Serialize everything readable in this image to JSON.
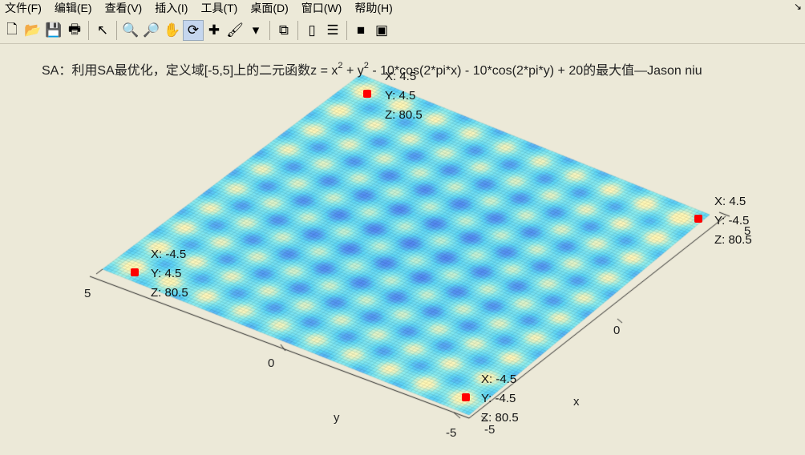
{
  "menu": [
    "文件(F)",
    "编辑(E)",
    "查看(V)",
    "插入(I)",
    "工具(T)",
    "桌面(D)",
    "窗口(W)",
    "帮助(H)"
  ],
  "corner_icon": "↘",
  "toolbar": [
    {
      "name": "new-figure-icon",
      "glyph": "🗋"
    },
    {
      "name": "open-icon",
      "glyph": "📂"
    },
    {
      "name": "save-icon",
      "glyph": "💾"
    },
    {
      "name": "print-icon",
      "glyph": "🖶"
    },
    {
      "sep": true
    },
    {
      "name": "select-arrow-icon",
      "glyph": "↖"
    },
    {
      "sep": true
    },
    {
      "name": "zoom-in-icon",
      "glyph": "🔍"
    },
    {
      "name": "zoom-out-icon",
      "glyph": "🔎"
    },
    {
      "name": "pan-hand-icon",
      "glyph": "✋"
    },
    {
      "name": "rotate-3d-icon",
      "glyph": "⟳",
      "active": true
    },
    {
      "name": "data-cursor-icon",
      "glyph": "✚"
    },
    {
      "name": "brush-icon",
      "glyph": "🖌"
    },
    {
      "name": "brush-dropdown-icon",
      "glyph": "▾"
    },
    {
      "sep": true
    },
    {
      "name": "link-plot-icon",
      "glyph": "⧉"
    },
    {
      "sep": true
    },
    {
      "name": "colorbar-icon",
      "glyph": "▯"
    },
    {
      "name": "legend-icon",
      "glyph": "☰"
    },
    {
      "sep": true
    },
    {
      "name": "hide-plot-tools-icon",
      "glyph": "■"
    },
    {
      "name": "show-plot-tools-icon",
      "glyph": "▣"
    }
  ],
  "title": {
    "prefix": "SA：利用SA最优化，定义域[-5,5]上的二元函数z =  x",
    "sup1": "2",
    "mid": " + y",
    "sup2": "2",
    "suffix": " - 10*cos(2*pi*x) - 10*cos(2*pi*y) + 20的最大值—Jason niu"
  },
  "chart_data": {
    "type": "surface",
    "function": "z = x^2 + y^2 - 10*cos(2*pi*x) - 10*cos(2*pi*y) + 20",
    "xlim": [
      -5,
      5
    ],
    "ylim": [
      -5,
      5
    ],
    "xlabel": "x",
    "ylabel": "y",
    "xticks": [
      "-5",
      "0",
      "5"
    ],
    "yticks": [
      "-5",
      "0",
      "5"
    ],
    "datatips": [
      {
        "x": 4.5,
        "y": 4.5,
        "z": 80.5,
        "lines": [
          "X: 4.5",
          "Y: 4.5",
          "Z: 80.5"
        ]
      },
      {
        "x": -4.5,
        "y": 4.5,
        "z": 80.5,
        "lines": [
          "X: -4.5",
          "Y: 4.5",
          "Z: 80.5"
        ]
      },
      {
        "x": 4.5,
        "y": -4.5,
        "z": 80.5,
        "lines": [
          "X: 4.5",
          "Y: -4.5",
          "Z: 80.5"
        ]
      },
      {
        "x": -4.5,
        "y": -4.5,
        "z": 80.5,
        "lines": [
          "X: -4.5",
          "Y: -4.5",
          "Z: 80.5"
        ]
      }
    ],
    "marker_color": "#ff0000"
  }
}
